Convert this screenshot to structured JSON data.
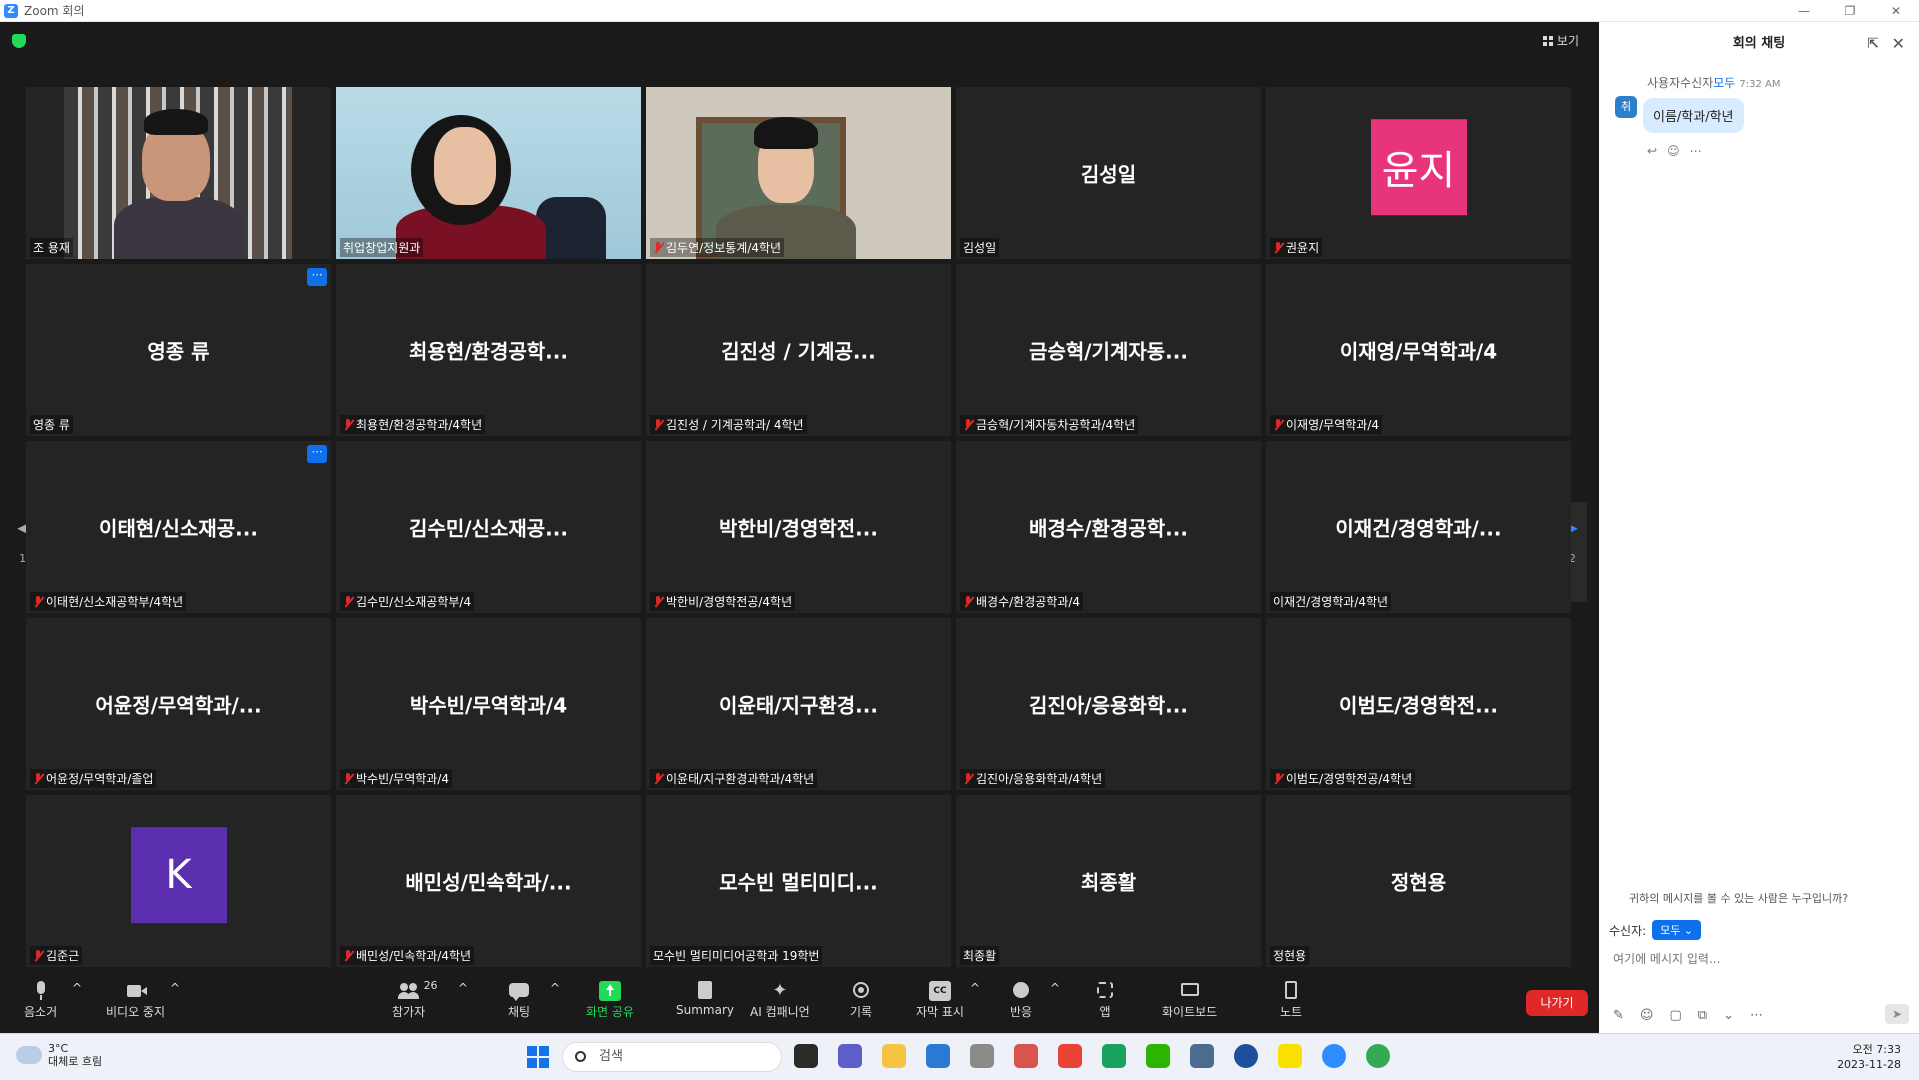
{
  "window": {
    "title": "Zoom 회의"
  },
  "meeting": {
    "view_label": "보기",
    "page_indicator": "1/2",
    "tiles": [
      {
        "type": "video",
        "label": "조 용재",
        "muted": false
      },
      {
        "type": "video",
        "label": "취업창업지원과",
        "muted": false,
        "active": true
      },
      {
        "type": "video",
        "label": "김두연/정보통계/4학년",
        "muted": true
      },
      {
        "type": "name",
        "name": "김성일",
        "label": "김성일",
        "muted": false
      },
      {
        "type": "avatar",
        "avatar_text": "윤지",
        "avatar_color": "#e8347a",
        "label": "권윤지",
        "muted": true
      },
      {
        "type": "name",
        "name": "영종 류",
        "label": "영종 류",
        "muted": false,
        "more": true
      },
      {
        "type": "name",
        "name": "최용현/환경공학...",
        "label": "최용현/환경공학과/4학년",
        "muted": true
      },
      {
        "type": "name",
        "name": "김진성 / 기계공...",
        "label": "김진성 / 기계공학과/ 4학년",
        "muted": true
      },
      {
        "type": "name",
        "name": "금승혁/기계자동...",
        "label": "금승혁/기계자동차공학과/4학년",
        "muted": true
      },
      {
        "type": "name",
        "name": "이재영/무역학과/4",
        "label": "이재영/무역학과/4",
        "muted": true
      },
      {
        "type": "name",
        "name": "이태현/신소재공...",
        "label": "이태현/신소재공학부/4학년",
        "muted": true,
        "more": true
      },
      {
        "type": "name",
        "name": "김수민/신소재공...",
        "label": "김수민/신소재공학부/4",
        "muted": true
      },
      {
        "type": "name",
        "name": "박한비/경영학전...",
        "label": "박한비/경영학전공/4학년",
        "muted": true
      },
      {
        "type": "name",
        "name": "배경수/환경공학...",
        "label": "배경수/환경공학과/4",
        "muted": true
      },
      {
        "type": "name",
        "name": "이재건/경영학과/...",
        "label": "이재건/경영학과/4학년",
        "muted": false
      },
      {
        "type": "name",
        "name": "어윤정/무역학과/...",
        "label": "어윤정/무역학과/졸업",
        "muted": true
      },
      {
        "type": "name",
        "name": "박수빈/무역학과/4",
        "label": "박수빈/무역학과/4",
        "muted": true
      },
      {
        "type": "name",
        "name": "이윤태/지구환경...",
        "label": "이윤태/지구환경과학과/4학년",
        "muted": true
      },
      {
        "type": "name",
        "name": "김진아/응용화학...",
        "label": "김진아/응용화학과/4학년",
        "muted": true
      },
      {
        "type": "name",
        "name": "이범도/경영학전...",
        "label": "이범도/경영학전공/4학년",
        "muted": true
      },
      {
        "type": "avatar",
        "avatar_text": "K",
        "avatar_color": "#5b2fb0",
        "label": "김준근",
        "muted": true
      },
      {
        "type": "name",
        "name": "배민성/민속학과/...",
        "label": "배민성/민속학과/4학년",
        "muted": true
      },
      {
        "type": "name",
        "name": "모수빈 멀티미디...",
        "label": "모수빈 멀티미디어공학과 19학번",
        "muted": false
      },
      {
        "type": "name",
        "name": "최종활",
        "label": "최종활",
        "muted": false
      },
      {
        "type": "name",
        "name": "정현용",
        "label": "정현용",
        "muted": false
      }
    ]
  },
  "toolbar": {
    "mute": "음소거",
    "video_stop": "비디오 중지",
    "participants": "참가자",
    "participant_count": "26",
    "chat": "채팅",
    "share_screen": "화면 공유",
    "summary": "Summary",
    "ai_companion": "AI 컴패니언",
    "record": "기록",
    "captions": "자막 표시",
    "reactions": "반응",
    "apps": "앱",
    "whiteboard": "화이트보드",
    "notes": "노트",
    "leave": "나가기"
  },
  "chat": {
    "title": "회의 채팅",
    "message": {
      "sender_prefix": "사용자수신자",
      "recipient": "모두",
      "time": "7:32 AM",
      "avatar": "취",
      "text": "이름/학과/학년"
    },
    "who_sees": "귀하의 메시지를 볼 수 있는 사람은 누구입니까?",
    "recipient_label": "수신자:",
    "recipient_value": "모두",
    "input_placeholder": "여기에 메시지 입력..."
  },
  "taskbar": {
    "temperature": "3°C",
    "weather": "대체로 흐림",
    "search_placeholder": "검색",
    "time": "오전 7:33",
    "date": "2023-11-28"
  },
  "colors": {
    "active_speaker": "#f4ea6b",
    "leave": "#e02828",
    "share": "#23d959",
    "accent": "#0e71eb"
  }
}
